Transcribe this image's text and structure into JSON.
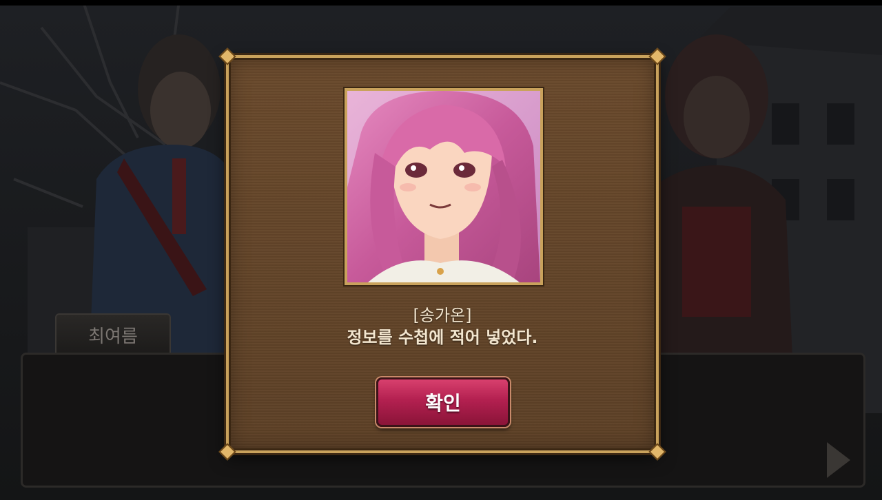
{
  "dialogue": {
    "speaker_name": "최여름"
  },
  "modal": {
    "character_name": "[송가온]",
    "message": "정보를 수첩에 적어 넣었다.",
    "confirm_label": "확인"
  },
  "colors": {
    "modal_bg": "#5e4127",
    "modal_border": "#c9a25c",
    "button_bg": "#b32050",
    "text_light": "#f3e6cf"
  },
  "icons": {
    "next": "next-arrow-icon"
  }
}
